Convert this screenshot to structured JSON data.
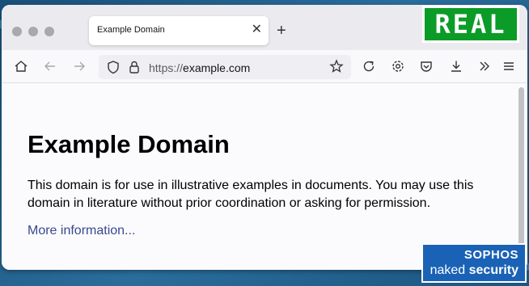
{
  "tab": {
    "title": "Example Domain",
    "close_glyph": "✕"
  },
  "toolbar": {
    "new_tab_glyph": "+"
  },
  "urlbar": {
    "scheme": "https://",
    "host": "example.com"
  },
  "page": {
    "heading": "Example Domain",
    "paragraph": "This domain is for use in illustrative examples in documents. You may use this domain in literature without prior coordination or asking for permission.",
    "link": "More information..."
  },
  "overlays": {
    "real_badge": "REAL",
    "sophos_brand": "SOPHOS",
    "sophos_tag_1": "naked ",
    "sophos_tag_2": "security"
  },
  "colors": {
    "link": "#38488f",
    "badge": "#0b9b27",
    "sophos": "#1a62b6"
  },
  "icons": [
    "home-icon",
    "back-icon",
    "forward-icon",
    "shield-icon",
    "lock-icon",
    "star-icon",
    "reload-icon",
    "gear-icon",
    "pocket-icon",
    "download-icon",
    "chevron-right-double-icon",
    "menu-icon"
  ]
}
